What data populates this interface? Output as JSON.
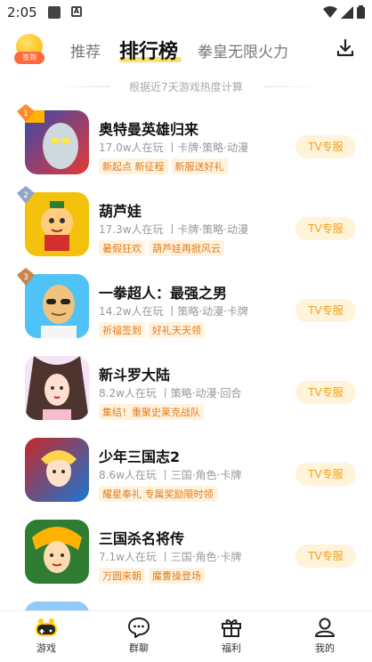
{
  "status": {
    "time": "2:05"
  },
  "header": {
    "signin_badge": "签到",
    "tabs": [
      "推荐",
      "排行榜",
      "拳皇无限火力"
    ]
  },
  "subtitle": "根据近7天游戏热度计算",
  "games": [
    {
      "title": "奥特曼英雄归来",
      "meta": "17.0w人在玩 丨卡牌·策略·动漫",
      "tags": [
        "新起点 新征程",
        "新服送好礼"
      ],
      "button": "TV专服",
      "rank_color": "#ff8a2a",
      "thumb_colors": [
        "#e53935",
        "#3949ab"
      ]
    },
    {
      "title": "葫芦娃",
      "meta": "17.3w人在玩 丨卡牌·策略·动漫",
      "tags": [
        "暑假狂欢",
        "葫芦娃再掀风云"
      ],
      "button": "TV专服",
      "rank_color": "#90a4c8",
      "thumb_colors": [
        "#f4c20d",
        "#d32f2f"
      ]
    },
    {
      "title": "一拳超人：最强之男",
      "meta": "14.2w人在玩 丨策略·动漫·卡牌",
      "tags": [
        "祈福签到",
        "好礼天天领"
      ],
      "button": "TV专服",
      "rank_color": "#c8864a",
      "thumb_colors": [
        "#4fc3f7",
        "#f1c27d"
      ]
    },
    {
      "title": "新斗罗大陆",
      "meta": "8.2w人在玩 丨策略·动漫·回合",
      "tags": [
        "集结！重聚史莱克战队"
      ],
      "button": "TV专服",
      "rank_color": "",
      "thumb_colors": [
        "#6d4c41",
        "#f8bbd0"
      ]
    },
    {
      "title": "少年三国志2",
      "meta": "8.6w人在玩 丨三国·角色·卡牌",
      "tags": [
        "耀星奉礼 专属奖励限时领"
      ],
      "button": "TV专服",
      "rank_color": "",
      "thumb_colors": [
        "#c62828",
        "#1976d2"
      ]
    },
    {
      "title": "三国杀名将传",
      "meta": "7.1w人在玩 丨三国·角色·卡牌",
      "tags": [
        "万圆来朝",
        "魔曹操登场"
      ],
      "button": "TV专服",
      "rank_color": "",
      "thumb_colors": [
        "#2e7d32",
        "#ffb300"
      ]
    }
  ],
  "bottom_nav": [
    {
      "label": "游戏",
      "icon": "gamepad-icon"
    },
    {
      "label": "群聊",
      "icon": "chat-icon"
    },
    {
      "label": "福利",
      "icon": "gift-icon"
    },
    {
      "label": "我的",
      "icon": "user-icon"
    }
  ]
}
